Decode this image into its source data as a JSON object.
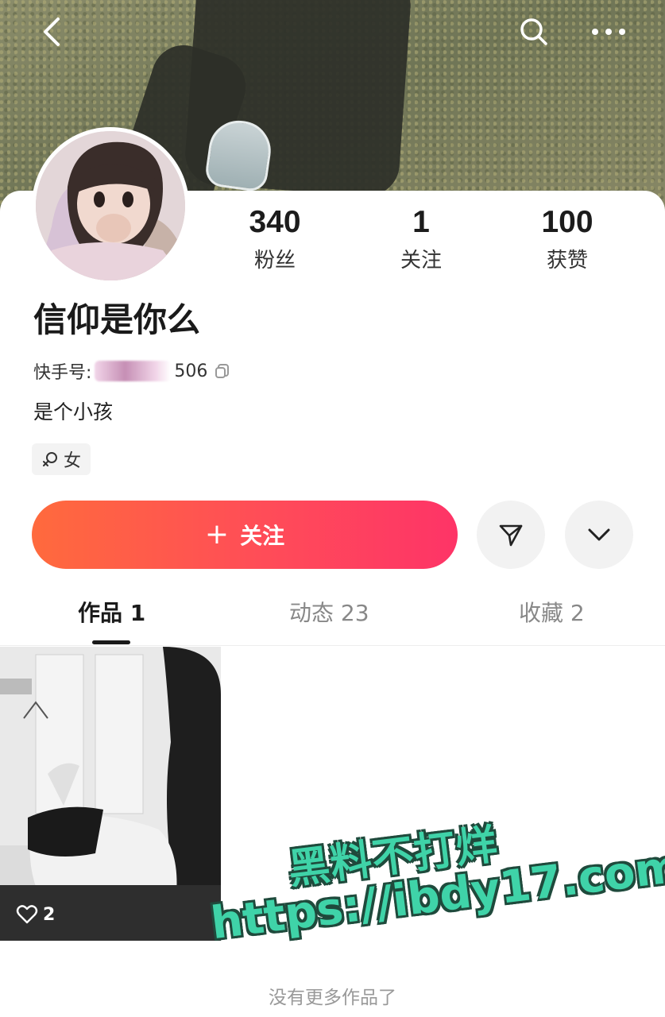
{
  "header": {
    "back_icon": "chevron-left-icon",
    "search_icon": "search-icon",
    "more_icon": "ellipsis-icon"
  },
  "profile": {
    "stats": [
      {
        "value": "340",
        "label": "粉丝"
      },
      {
        "value": "1",
        "label": "关注"
      },
      {
        "value": "100",
        "label": "获赞"
      }
    ],
    "username": "信仰是你么",
    "uid_prefix": "快手号:",
    "uid_suffix": "506",
    "bio": "是个小孩",
    "gender_tag": "女"
  },
  "actions": {
    "follow_plus": "+",
    "follow_label": "关注",
    "share_icon": "send-icon",
    "expand_icon": "chevron-down-icon"
  },
  "tabs": [
    {
      "label": "作品 1",
      "active": true
    },
    {
      "label": "动态 23",
      "active": false
    },
    {
      "label": "收藏 2",
      "active": false
    }
  ],
  "works": [
    {
      "likes": "2"
    }
  ],
  "watermark": {
    "line1": "黑料不打烊",
    "line2": "https://ibdy17.com"
  },
  "footer": {
    "no_more": "没有更多作品了"
  },
  "colors": {
    "follow_gradient_start": "#ff6a3d",
    "follow_gradient_end": "#fe3467",
    "watermark": "#3fd3a8"
  }
}
